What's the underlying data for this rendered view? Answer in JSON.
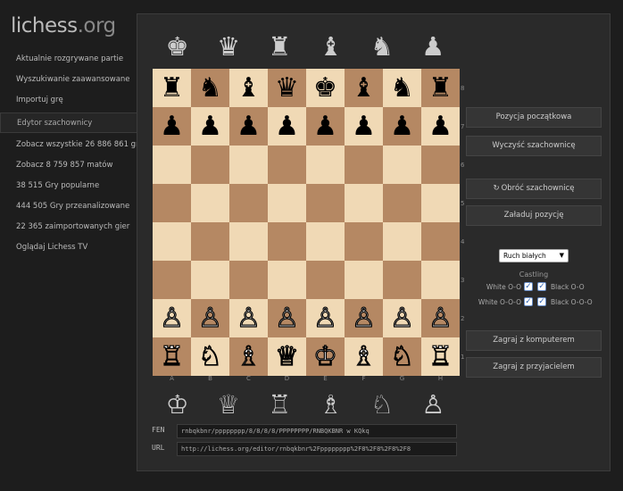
{
  "brand": {
    "main": "lichess",
    "suffix": ".org"
  },
  "sidebar": {
    "items": [
      {
        "label": "Aktualnie rozgrywane partie"
      },
      {
        "label": "Wyszukiwanie zaawansowane"
      },
      {
        "label": "Importuj grę"
      },
      {
        "label": "Edytor szachownicy",
        "active": true
      },
      {
        "label": "Zobacz wszystkie 26 886 861 gry"
      },
      {
        "label": "Zobacz 8 759 857 matów"
      },
      {
        "label": "38 515 Gry popularne"
      },
      {
        "label": "444 505 Gry przeanalizowane"
      },
      {
        "label": "22 365 zaimportowanych gier"
      },
      {
        "label": "Oglądaj Lichess TV"
      }
    ]
  },
  "spare_top": [
    "♚",
    "♛",
    "♜",
    "♝",
    "♞",
    "♟"
  ],
  "spare_bottom": [
    "♔",
    "♕",
    "♖",
    "♗",
    "♘",
    "♙"
  ],
  "board": {
    "rows": [
      "rnbqkbnr",
      "pppppppp",
      "........",
      "........",
      "........",
      "........",
      "PPPPPPPP",
      "RNBQKBNR"
    ],
    "files": [
      "A",
      "B",
      "C",
      "D",
      "E",
      "F",
      "G",
      "H"
    ],
    "ranks": [
      "8",
      "7",
      "6",
      "5",
      "4",
      "3",
      "2",
      "1"
    ]
  },
  "buttons": {
    "start_position": "Pozycja początkowa",
    "clear_board": "Wyczyść szachownicę",
    "flip_icon": "↻",
    "flip_board": "Obróć szachownicę",
    "load_position": "Załaduj pozycję",
    "play_computer": "Zagraj z komputerem",
    "play_friend": "Zagraj z przyjacielem"
  },
  "turn": {
    "selected": "Ruch białych"
  },
  "castling": {
    "title": "Castling",
    "white_oo": "White O-O",
    "black_oo": "Black O-O",
    "white_ooo": "White O-O-O",
    "black_ooo": "Black O-O-O",
    "check": "✓"
  },
  "fen": {
    "label": "FEN",
    "value": "rnbqkbnr/pppppppp/8/8/8/8/PPPPPPPP/RNBQKBNR w KQkq"
  },
  "url": {
    "label": "URL",
    "value": "http://lichess.org/editor/rnbqkbnr%2Fpppppppp%2F8%2F8%2F8%2F8"
  },
  "colors": {
    "light_square": "#f0d9b5",
    "dark_square": "#b58863",
    "background": "#1d1d1d",
    "panel": "#2a2a2a"
  }
}
